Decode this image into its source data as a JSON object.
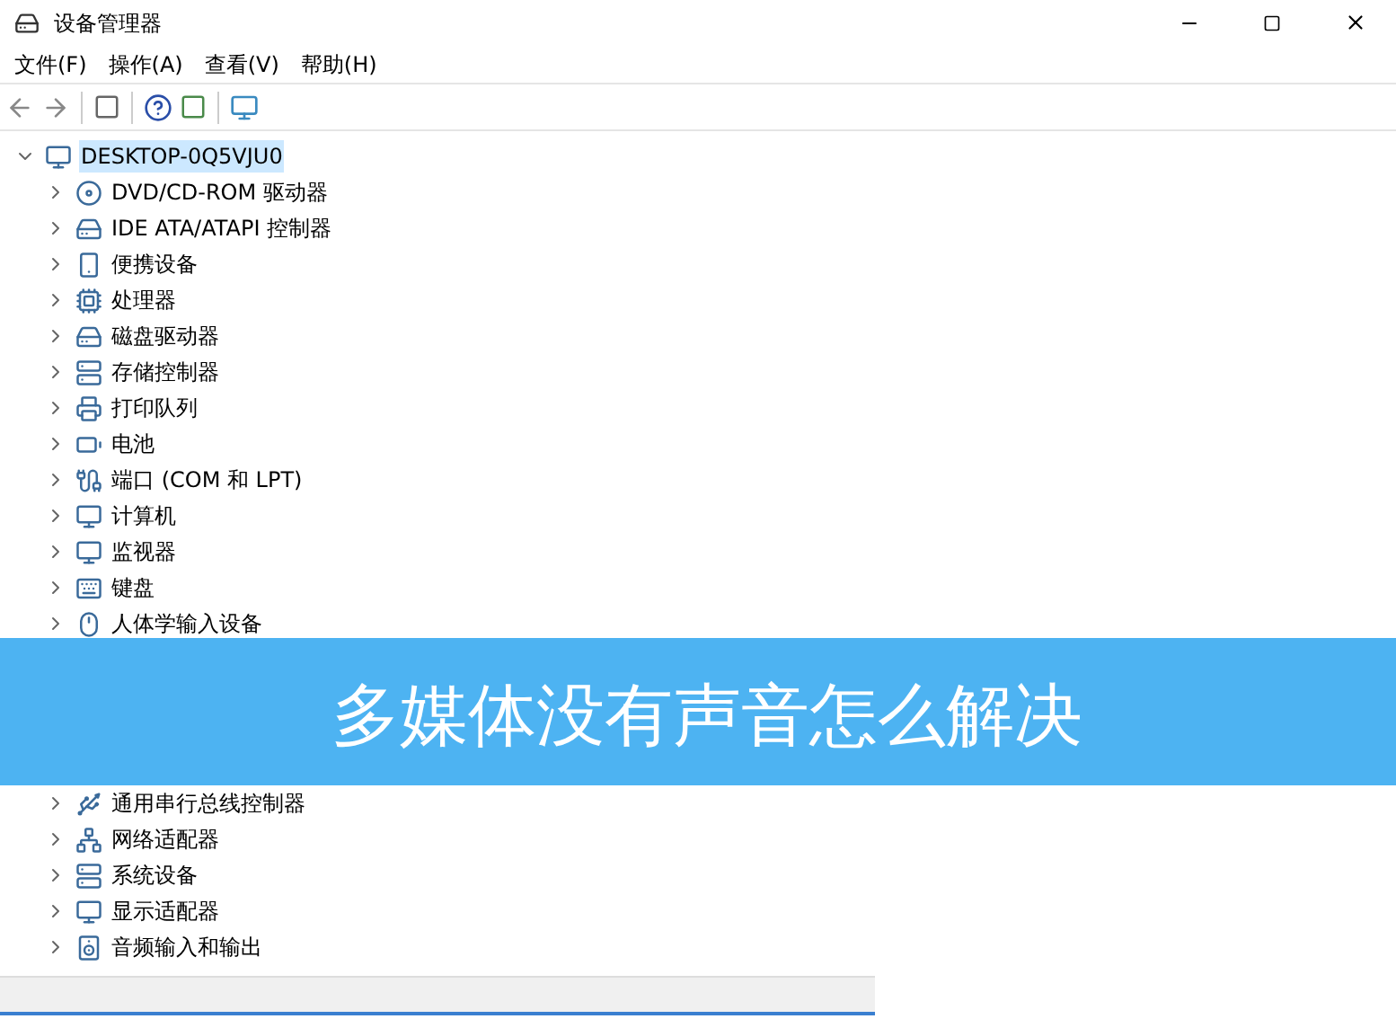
{
  "window": {
    "title": "设备管理器"
  },
  "menu": [
    "文件(F)",
    "操作(A)",
    "查看(V)",
    "帮助(H)"
  ],
  "tree": {
    "label": "DESKTOP-0Q5VJU0",
    "expanded": true,
    "selected": true,
    "children": [
      {
        "label": "DVD/CD-ROM 驱动器",
        "expanded": false,
        "selected": false
      },
      {
        "label": "IDE ATA/ATAPI 控制器",
        "expanded": false,
        "selected": false
      },
      {
        "label": "便携设备",
        "expanded": false,
        "selected": false
      },
      {
        "label": "处理器",
        "expanded": false,
        "selected": false
      },
      {
        "label": "磁盘驱动器",
        "expanded": false,
        "selected": false
      },
      {
        "label": "存储控制器",
        "expanded": false,
        "selected": false
      },
      {
        "label": "打印队列",
        "expanded": false,
        "selected": false
      },
      {
        "label": "电池",
        "expanded": false,
        "selected": false
      },
      {
        "label": "端口 (COM 和 LPT)",
        "expanded": false,
        "selected": false
      },
      {
        "label": "计算机",
        "expanded": false,
        "selected": false
      },
      {
        "label": "监视器",
        "expanded": false,
        "selected": false
      },
      {
        "label": "键盘",
        "expanded": false,
        "selected": false
      },
      {
        "label": "人体学输入设备",
        "expanded": false,
        "selected": false
      }
    ]
  },
  "banner": {
    "title": "多媒体没有声音怎么解决"
  },
  "tree_continued": [
    {
      "label": "通用串行总线控制器",
      "expanded": false,
      "selected": false
    },
    {
      "label": "网络适配器",
      "expanded": false,
      "selected": false
    },
    {
      "label": "系统设备",
      "expanded": false,
      "selected": false
    },
    {
      "label": "显示适配器",
      "expanded": false,
      "selected": false
    },
    {
      "label": "音频输入和输出",
      "expanded": false,
      "selected": false
    }
  ]
}
